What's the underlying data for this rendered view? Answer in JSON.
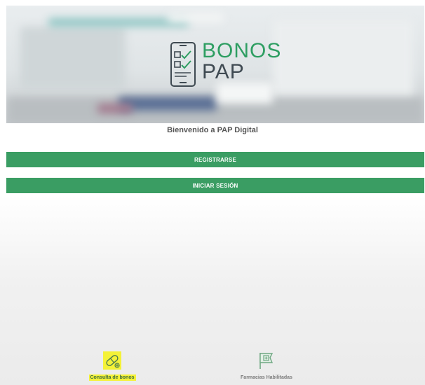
{
  "brand": {
    "line1": "BONOS",
    "line2": "PAP",
    "colors": {
      "brand_green": "#2e9e62",
      "brand_dark": "#3f4a52"
    }
  },
  "welcome_text": "Bienvenido a PAP Digital",
  "buttons": {
    "register_label": "REGISTRARSE",
    "login_label": "INICIAR SESIÓN",
    "color": "#3a9d63"
  },
  "bottom_nav": {
    "items": [
      {
        "label": "Consulta de bonos",
        "icon": "pill-icon",
        "highlighted": true
      },
      {
        "label": "Farmacias Habilitadas",
        "icon": "pharmacy-flag-icon",
        "highlighted": false
      }
    ],
    "highlight_color": "#f4f238"
  }
}
